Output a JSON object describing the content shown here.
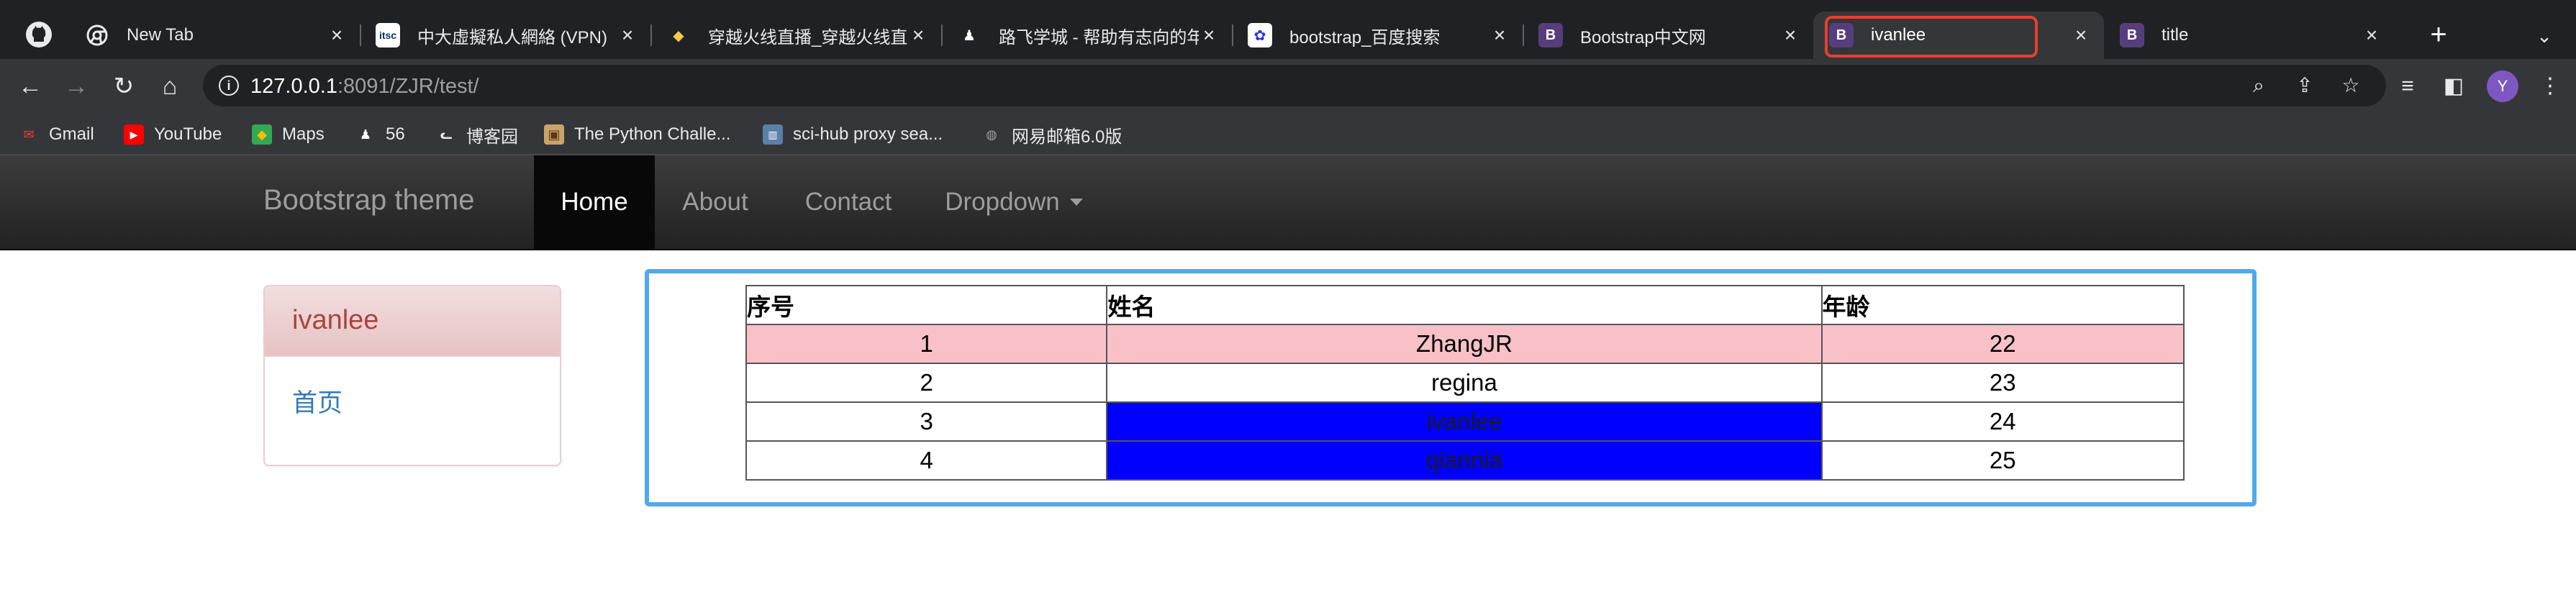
{
  "browser": {
    "tabs": [
      {
        "title": "New Tab",
        "icon": "chrome-icon"
      },
      {
        "title": "中大虛擬私人網絡 (VPN) ",
        "icon": "itsc-icon"
      },
      {
        "title": "穿越火线直播_穿越火线直",
        "icon": "game-icon"
      },
      {
        "title": "路飞学城 - 帮助有志向的年",
        "icon": "luffy-icon"
      },
      {
        "title": "bootstrap_百度搜索",
        "icon": "baidu-icon"
      },
      {
        "title": "Bootstrap中文网",
        "icon": "bootstrap-icon"
      },
      {
        "title": "ivanlee",
        "icon": "bootstrap-icon"
      },
      {
        "title": "title",
        "icon": "bootstrap-icon"
      }
    ],
    "active_tab_index": 6,
    "url_host": "127.0.0.1",
    "url_rest": ":8091/ZJR/test/",
    "profile_initial": "Y",
    "bookmarks": [
      {
        "label": "Gmail",
        "icon": "gmail-icon"
      },
      {
        "label": "YouTube",
        "icon": "youtube-icon"
      },
      {
        "label": "Maps",
        "icon": "maps-icon"
      },
      {
        "label": "56",
        "icon": "runner-icon"
      },
      {
        "label": "博客园",
        "icon": "cnblogs-icon"
      },
      {
        "label": "The Python Challe...",
        "icon": "python-challenge-icon"
      },
      {
        "label": "sci-hub proxy sea...",
        "icon": "scihub-icon"
      },
      {
        "label": "网易邮箱6.0版",
        "icon": "globe-icon"
      }
    ]
  },
  "navbar": {
    "brand": "Bootstrap theme",
    "items": [
      {
        "label": "Home",
        "active": true
      },
      {
        "label": "About",
        "active": false
      },
      {
        "label": "Contact",
        "active": false
      },
      {
        "label": "Dropdown",
        "active": false
      }
    ]
  },
  "panel": {
    "heading": "ivanlee",
    "link": "首页"
  },
  "table": {
    "headers": [
      "序号",
      "姓名",
      "年龄"
    ],
    "rows": [
      {
        "id": "1",
        "name": "ZhangJR",
        "age": "22"
      },
      {
        "id": "2",
        "name": "regina",
        "age": "23"
      },
      {
        "id": "3",
        "name": "ivanlee",
        "age": "24"
      },
      {
        "id": "4",
        "name": "qiannia",
        "age": "25"
      }
    ]
  },
  "colors": {
    "row_highlight": "#f8c1c8",
    "cell_highlight": "#0000ff",
    "content_border": "#52a8ec",
    "tab_callout": "#e8402d"
  }
}
